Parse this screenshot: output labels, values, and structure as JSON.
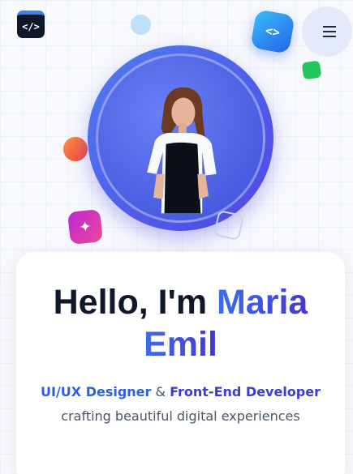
{
  "header": {
    "logo_glyph": "</>",
    "menu_icon": "hamburger-icon"
  },
  "decorations": {
    "code_badge_glyph": "<>",
    "sparkle_glyph": "✦"
  },
  "hero": {
    "greeting": "Hello, I'm",
    "first_name": "Maria",
    "last_name": "Emil",
    "role_1": "UI/UX Designer",
    "connector": "&",
    "role_2": "Front-End Developer",
    "tagline": "crafting beautiful digital experiences"
  },
  "colors": {
    "accent_blue": "#3b6ef0",
    "accent_indigo": "#4338ca",
    "heading": "#0f172a"
  }
}
